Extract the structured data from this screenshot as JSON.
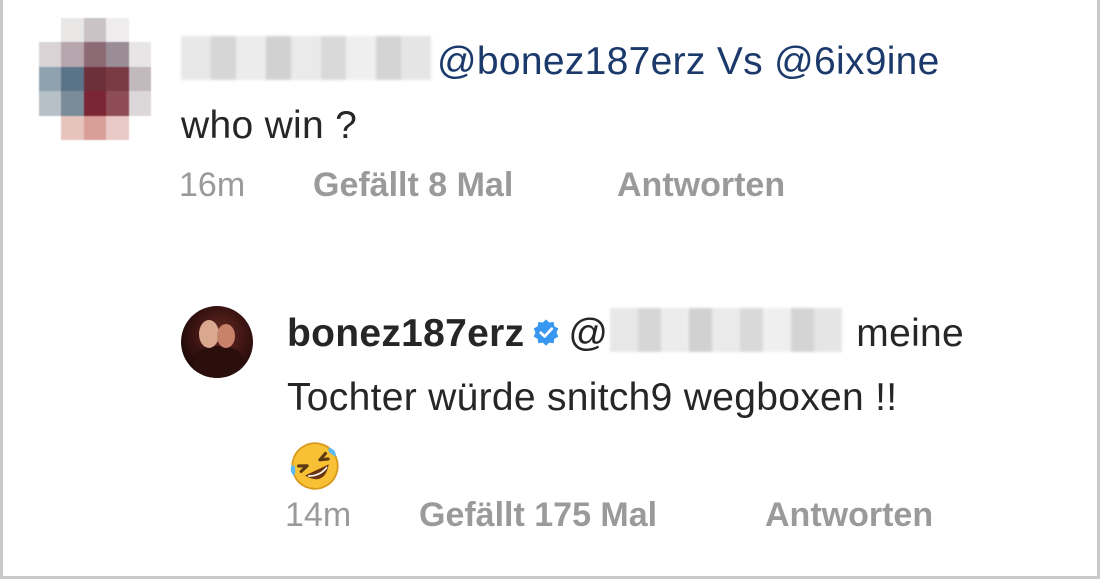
{
  "comment": {
    "mentions": "@bonez187erz Vs @6ix9ine",
    "text": "who win ?",
    "time": "16m",
    "likes": "Gefällt 8 Mal",
    "reply_label": "Antworten"
  },
  "reply": {
    "username": "bonez187erz",
    "mention_prefix": "@",
    "text_line1_end": "meine",
    "text_line2": "Tochter würde snitch9 wegboxen !!",
    "emoji": "rolling-on-floor-laughing",
    "time": "14m",
    "likes": "Gefällt 175 Mal",
    "reply_label": "Antworten",
    "verified_color": "#3897f0"
  },
  "colors": {
    "text": "#262626",
    "meta": "#9a9a9a",
    "mention": "#1b3a6b"
  },
  "icons": {
    "avatar_blurred": "pixelated-avatar",
    "avatar_reply": "profile-photo",
    "verified": "verified-badge-icon"
  }
}
